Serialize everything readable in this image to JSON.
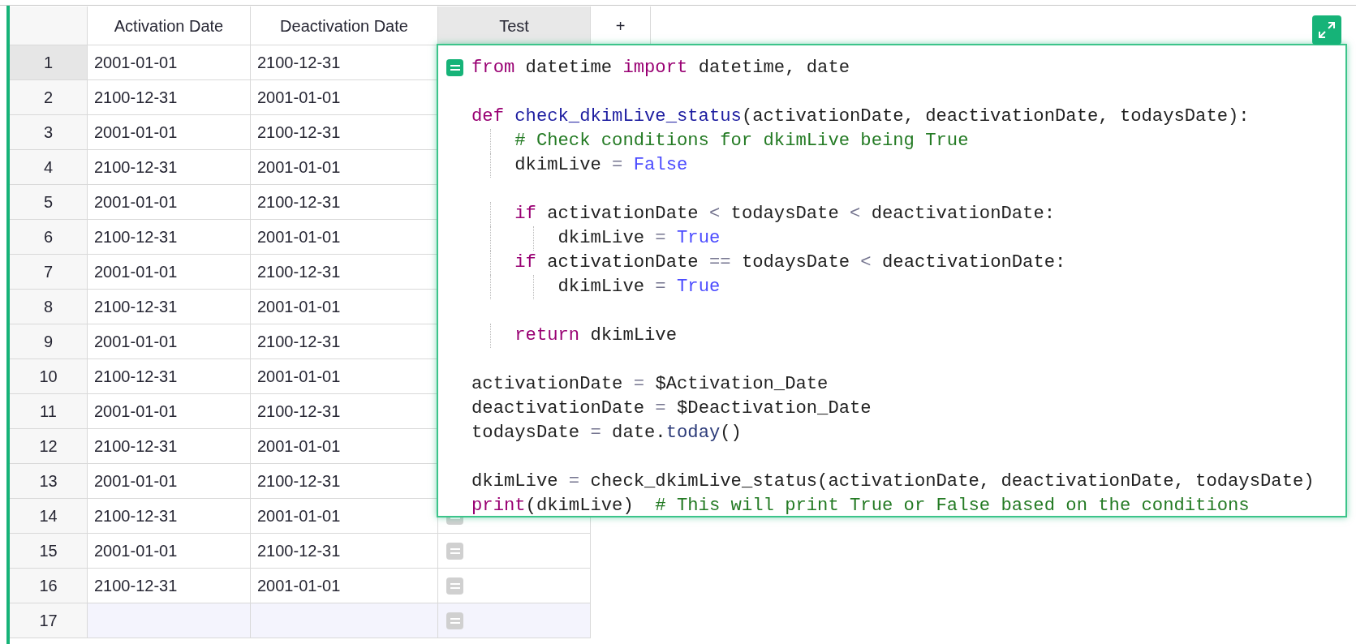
{
  "columns": [
    {
      "label": "Activation Date",
      "selected": false
    },
    {
      "label": "Deactivation Date",
      "selected": false
    },
    {
      "label": "Test",
      "selected": true
    }
  ],
  "add_column_button": "+",
  "rows": [
    {
      "kind": "data",
      "number": "1",
      "activation": "2001-01-01",
      "deactivation": "2100-12-31",
      "selected": true
    },
    {
      "kind": "data",
      "number": "2",
      "activation": "2100-12-31",
      "deactivation": "2001-01-01",
      "selected": false
    },
    {
      "kind": "data",
      "number": "3",
      "activation": "2001-01-01",
      "deactivation": "2100-12-31",
      "selected": false
    },
    {
      "kind": "data",
      "number": "4",
      "activation": "2100-12-31",
      "deactivation": "2001-01-01",
      "selected": false
    },
    {
      "kind": "data",
      "number": "5",
      "activation": "2001-01-01",
      "deactivation": "2100-12-31",
      "selected": false
    },
    {
      "kind": "data",
      "number": "6",
      "activation": "2100-12-31",
      "deactivation": "2001-01-01",
      "selected": false
    },
    {
      "kind": "data",
      "number": "7",
      "activation": "2001-01-01",
      "deactivation": "2100-12-31",
      "selected": false
    },
    {
      "kind": "data",
      "number": "8",
      "activation": "2100-12-31",
      "deactivation": "2001-01-01",
      "selected": false
    },
    {
      "kind": "data",
      "number": "9",
      "activation": "2001-01-01",
      "deactivation": "2100-12-31",
      "selected": false
    },
    {
      "kind": "data",
      "number": "10",
      "activation": "2100-12-31",
      "deactivation": "2001-01-01",
      "selected": false
    },
    {
      "kind": "data",
      "number": "11",
      "activation": "2001-01-01",
      "deactivation": "2100-12-31",
      "selected": false
    },
    {
      "kind": "data",
      "number": "12",
      "activation": "2100-12-31",
      "deactivation": "2001-01-01",
      "selected": false
    },
    {
      "kind": "data",
      "number": "13",
      "activation": "2001-01-01",
      "deactivation": "2100-12-31",
      "selected": false
    },
    {
      "kind": "data",
      "number": "14",
      "activation": "2100-12-31",
      "deactivation": "2001-01-01",
      "selected": false
    },
    {
      "kind": "data",
      "number": "15",
      "activation": "2001-01-01",
      "deactivation": "2100-12-31",
      "selected": false
    },
    {
      "kind": "data",
      "number": "16",
      "activation": "2100-12-31",
      "deactivation": "2001-01-01",
      "selected": false
    },
    {
      "kind": "new",
      "number": "17",
      "selected": false
    }
  ],
  "editor": {
    "lines": [
      {
        "kind": "code",
        "tokens": [
          {
            "kind": "keyword",
            "text": "from"
          },
          {
            "kind": "plain",
            "text": " datetime "
          },
          {
            "kind": "keyword",
            "text": "import"
          },
          {
            "kind": "plain",
            "text": " datetime, date"
          }
        ]
      },
      {
        "kind": "blank"
      },
      {
        "kind": "code",
        "tokens": [
          {
            "kind": "keyword",
            "text": "def "
          },
          {
            "kind": "function",
            "text": "check_dkimLive_status"
          },
          {
            "kind": "plain",
            "text": "(activationDate, deactivationDate, todaysDate):"
          }
        ]
      },
      {
        "kind": "code",
        "tokens": [
          {
            "kind": "comment",
            "text": "    # Check conditions for dkimLive being True"
          }
        ]
      },
      {
        "kind": "code",
        "tokens": [
          {
            "kind": "plain",
            "text": "    dkimLive "
          },
          {
            "kind": "operator",
            "text": "= "
          },
          {
            "kind": "constant",
            "text": "False"
          }
        ]
      },
      {
        "kind": "blank"
      },
      {
        "kind": "code",
        "tokens": [
          {
            "kind": "keyword",
            "text": "    if"
          },
          {
            "kind": "plain",
            "text": " activationDate "
          },
          {
            "kind": "operator",
            "text": "<"
          },
          {
            "kind": "plain",
            "text": " todaysDate "
          },
          {
            "kind": "operator",
            "text": "<"
          },
          {
            "kind": "plain",
            "text": " deactivationDate:"
          }
        ]
      },
      {
        "kind": "code",
        "tokens": [
          {
            "kind": "plain",
            "text": "        dkimLive "
          },
          {
            "kind": "operator",
            "text": "= "
          },
          {
            "kind": "constant",
            "text": "True"
          }
        ]
      },
      {
        "kind": "code",
        "tokens": [
          {
            "kind": "keyword",
            "text": "    if"
          },
          {
            "kind": "plain",
            "text": " activationDate "
          },
          {
            "kind": "operator",
            "text": "=="
          },
          {
            "kind": "plain",
            "text": " todaysDate "
          },
          {
            "kind": "operator",
            "text": "<"
          },
          {
            "kind": "plain",
            "text": " deactivationDate:"
          }
        ]
      },
      {
        "kind": "code",
        "tokens": [
          {
            "kind": "plain",
            "text": "        dkimLive "
          },
          {
            "kind": "operator",
            "text": "= "
          },
          {
            "kind": "constant",
            "text": "True"
          }
        ]
      },
      {
        "kind": "blank"
      },
      {
        "kind": "code",
        "tokens": [
          {
            "kind": "keyword",
            "text": "    return"
          },
          {
            "kind": "plain",
            "text": " dkimLive"
          }
        ]
      },
      {
        "kind": "blank"
      },
      {
        "kind": "code",
        "tokens": [
          {
            "kind": "plain",
            "text": "activationDate "
          },
          {
            "kind": "operator",
            "text": "="
          },
          {
            "kind": "plain",
            "text": " $Activation_Date"
          }
        ]
      },
      {
        "kind": "code",
        "tokens": [
          {
            "kind": "plain",
            "text": "deactivationDate "
          },
          {
            "kind": "operator",
            "text": "="
          },
          {
            "kind": "plain",
            "text": " $Deactivation_Date"
          }
        ]
      },
      {
        "kind": "code",
        "tokens": [
          {
            "kind": "plain",
            "text": "todaysDate "
          },
          {
            "kind": "operator",
            "text": "="
          },
          {
            "kind": "plain",
            "text": " date."
          },
          {
            "kind": "method",
            "text": "today"
          },
          {
            "kind": "plain",
            "text": "()"
          }
        ]
      },
      {
        "kind": "blank"
      },
      {
        "kind": "code",
        "tokens": [
          {
            "kind": "plain",
            "text": "dkimLive "
          },
          {
            "kind": "operator",
            "text": "="
          },
          {
            "kind": "plain",
            "text": " check_dkimLive_status(activationDate, deactivationDate, todaysDate)"
          }
        ]
      },
      {
        "kind": "code",
        "tokens": [
          {
            "kind": "keyword",
            "text": "print"
          },
          {
            "kind": "plain",
            "text": "(dkimLive)  "
          },
          {
            "kind": "comment",
            "text": "# This will print True or False based on the conditions"
          }
        ]
      }
    ]
  }
}
